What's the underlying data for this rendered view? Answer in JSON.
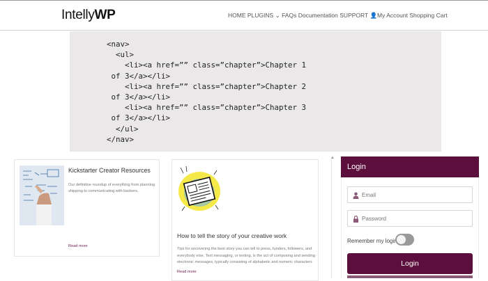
{
  "header": {
    "logo_bold": "Intelly",
    "logo_wp": "WP",
    "nav_items": [
      "HOME",
      "PLUGINS",
      "FAQs",
      "Documentation",
      "SUPPORT",
      "My Account",
      "Shopping Cart"
    ]
  },
  "code_block": {
    "lines": [
      "<nav>",
      "  <ul>",
      "    <li><a href=”” class=”chapter”>Chapter 1",
      " of 3</a></li>",
      "    <li><a href=”” class=”chapter”>Chapter 2",
      " of 3</a></li>",
      "    <li><a href=”” class=”chapter”>Chapter 3",
      " of 3</a></li>",
      "  </ul>",
      "</nav>"
    ]
  },
  "cards": [
    {
      "title": "Kickstarter Creator Resources",
      "description": "Our definitive roundup of everything from planning shipping to communicating with backers.",
      "read_more": "Read more",
      "thumb_icon": "whiteboard-photo"
    },
    {
      "title": "How to tell the story of your creative work",
      "description": "Tips for uncovering the best story you can tell to press, funders, followers, and everybody else. Text messaging, or texting, is the act of composing and sending electronic messages, typically consisting of alphabetic and numeric characters",
      "read_more": "Read more",
      "thumb_icon": "newspaper-illustration"
    }
  ],
  "login": {
    "title": "Login",
    "email_placeholder": "Email",
    "password_placeholder": "Password",
    "remember_label": "Remember my login",
    "remember_on": false,
    "button_label": "Login"
  },
  "colors": {
    "brand": "#5c0f3c",
    "code_bg": "#ebe8ea"
  }
}
